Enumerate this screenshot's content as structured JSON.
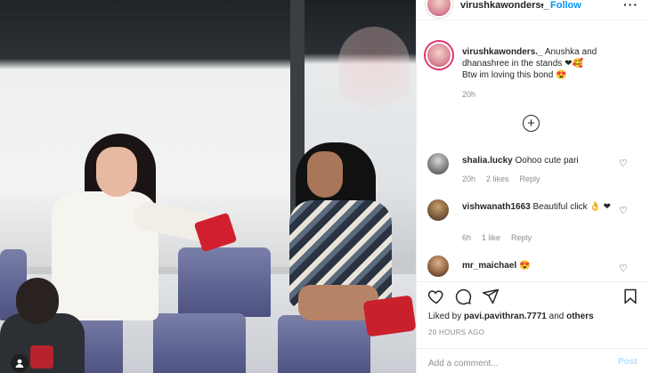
{
  "post": {
    "username": "virushkawonders._",
    "follow_label": "Follow",
    "header_separator": "•",
    "more_icon": "more-horizontal-icon",
    "caption": {
      "username": "virushkawonders._",
      "line1": "Anushka and dhanashree in the stands ❤🥰",
      "line2": "Btw im loving this bond 😍",
      "time": "20h"
    },
    "load_more_icon": "plus-circle-icon",
    "comments": [
      {
        "username": "shalia.lucky",
        "text": "Oohoo cute pari",
        "time": "20h",
        "likes": "2 likes",
        "reply": "Reply"
      },
      {
        "username": "vishwanath1663",
        "text": "Beautiful click 👌 ❤",
        "time": "6h",
        "likes": "1 like",
        "reply": "Reply"
      },
      {
        "username": "mr_maichael",
        "text": "😍",
        "time": "",
        "likes": "",
        "reply": ""
      }
    ],
    "actions": {
      "like_icon": "heart-icon",
      "comment_icon": "comment-icon",
      "share_icon": "send-icon",
      "save_icon": "bookmark-icon"
    },
    "liked_by": {
      "prefix": "Liked by",
      "user": "pavi.pavithran.7771",
      "connector": "and",
      "others": "others"
    },
    "timestamp": "20 HOURS AGO",
    "comment_input": {
      "placeholder": "Add a comment...",
      "post_label": "Post"
    }
  },
  "colors": {
    "accent": "#0095f6",
    "post_disabled": "#b2dffc",
    "muted": "#8e8e8e",
    "text": "#262626"
  }
}
